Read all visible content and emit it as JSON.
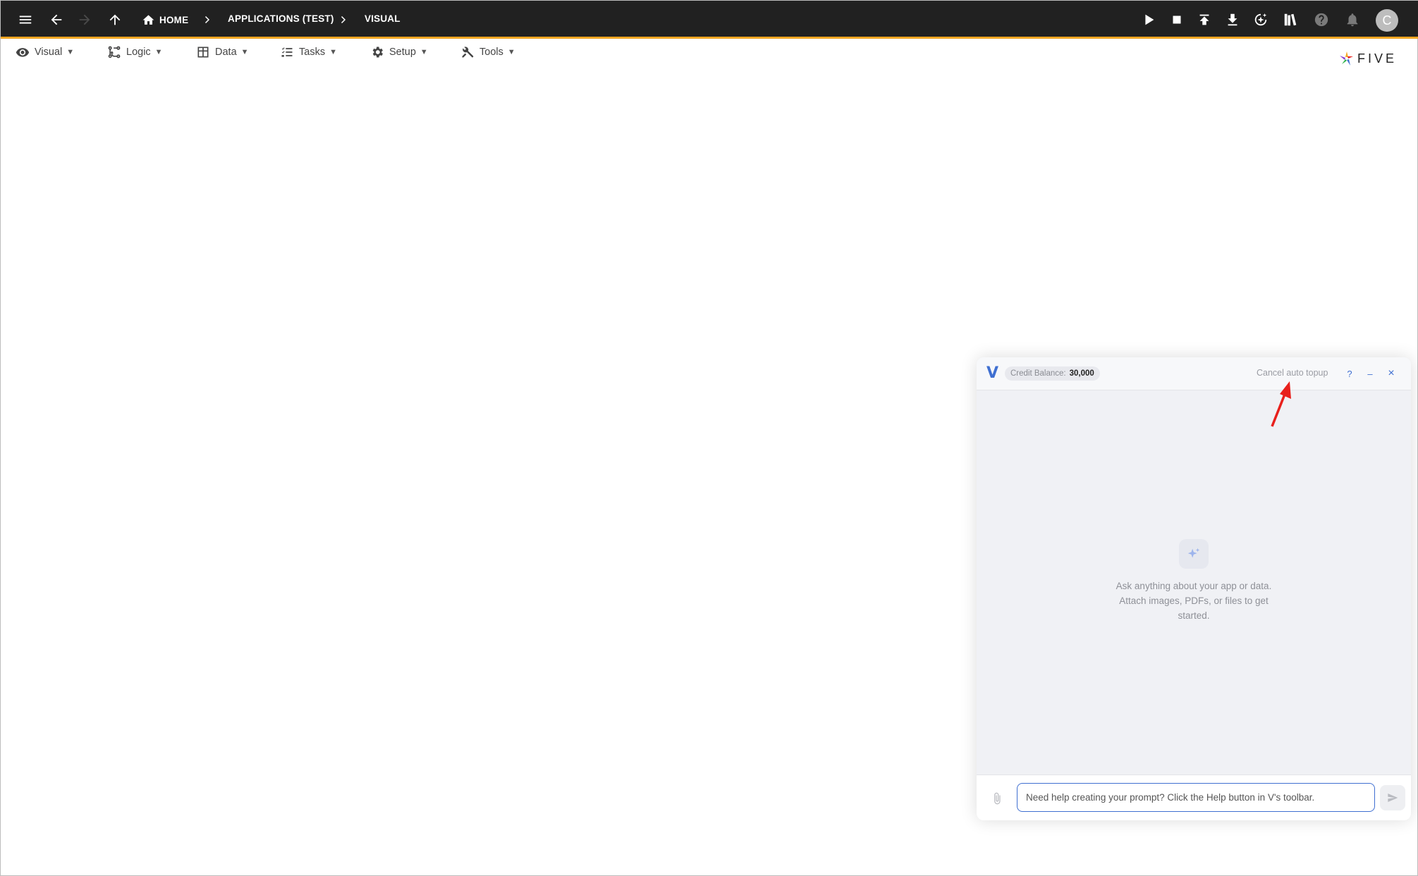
{
  "topbar": {
    "breadcrumbs": [
      {
        "label": "HOME"
      },
      {
        "label": "APPLICATIONS (TEST)"
      },
      {
        "label": "VISUAL"
      }
    ],
    "avatar_letter": "C"
  },
  "menubar": {
    "items": [
      {
        "label": "Visual",
        "icon": "eye-icon"
      },
      {
        "label": "Logic",
        "icon": "logic-icon"
      },
      {
        "label": "Data",
        "icon": "table-icon"
      },
      {
        "label": "Tasks",
        "icon": "tasks-icon"
      },
      {
        "label": "Setup",
        "icon": "gear-icon"
      },
      {
        "label": "Tools",
        "icon": "tools-icon"
      }
    ],
    "caret": "▼"
  },
  "logo": {
    "text": "FIVE"
  },
  "chat": {
    "logo_letter": "V",
    "credit_label": "Credit Balance:",
    "credit_value": "30,000",
    "cancel_label": "Cancel auto topup",
    "help_label": "?",
    "minimize_label": "–",
    "close_label": "×",
    "empty_line1": "Ask anything about your app or data.",
    "empty_line2": "Attach images, PDFs, or files to get",
    "empty_line3": "started.",
    "prompt_placeholder": "Need help creating your prompt? Click the Help button in V's toolbar."
  },
  "colors": {
    "topbar_bg": "#212121",
    "accent_bar": "#f5a623",
    "brand_blue": "#3f6fd1",
    "annotation_arrow": "#e8201c"
  }
}
